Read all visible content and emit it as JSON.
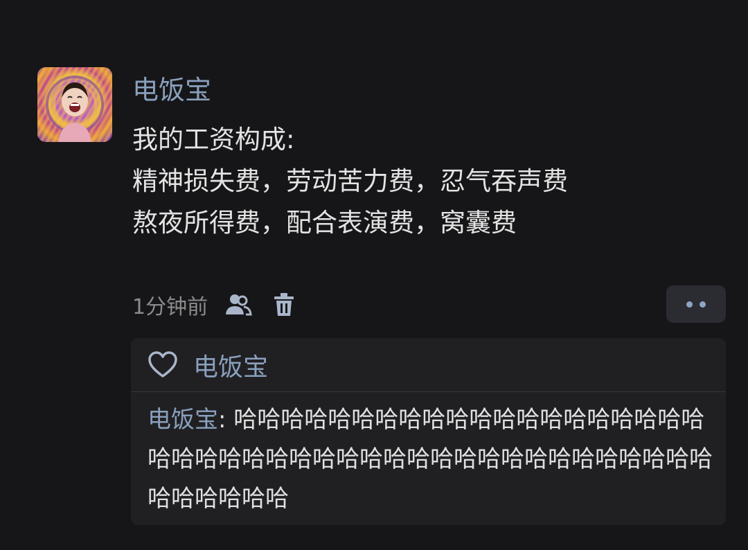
{
  "post": {
    "author": "电饭宝",
    "content_lines": [
      "我的工资构成:",
      "精神损失费，劳动苦力费，忍气吞声费",
      "熬夜所得费，配合表演费，窝囊费"
    ],
    "timestamp": "1分钟前",
    "icons": {
      "visibility": "people-icon",
      "delete": "trash-icon",
      "more": "more-dots-icon"
    }
  },
  "reactions": {
    "like_icon": "heart-outline-icon",
    "likers": "电饭宝"
  },
  "comments": [
    {
      "author": "电饭宝",
      "separator": ": ",
      "text": "哈哈哈哈哈哈哈哈哈哈哈哈哈哈哈哈哈哈哈哈哈哈哈哈哈哈哈哈哈哈哈哈哈哈哈哈哈哈哈哈哈哈哈哈哈哈哈哈哈哈"
    }
  ],
  "colors": {
    "background": "#161618",
    "name_link": "#8aa0bd",
    "text": "#e3e3e3",
    "muted": "#8b8b8b",
    "panel": "#202023",
    "accent_dots": "#8da4c4"
  }
}
